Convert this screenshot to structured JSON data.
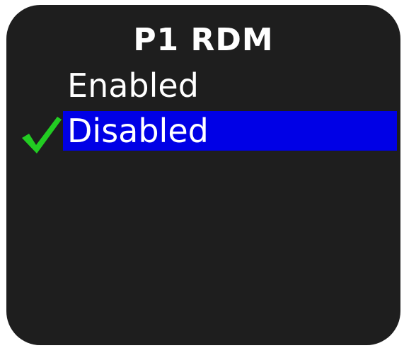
{
  "screen": {
    "title": "P1 RDM",
    "options": [
      {
        "label": "Enabled",
        "selected": false
      },
      {
        "label": "Disabled",
        "selected": true
      }
    ],
    "highlight_color": "#0000e6",
    "check_color": "#22cc22",
    "check_icon": "checkmark-icon"
  }
}
